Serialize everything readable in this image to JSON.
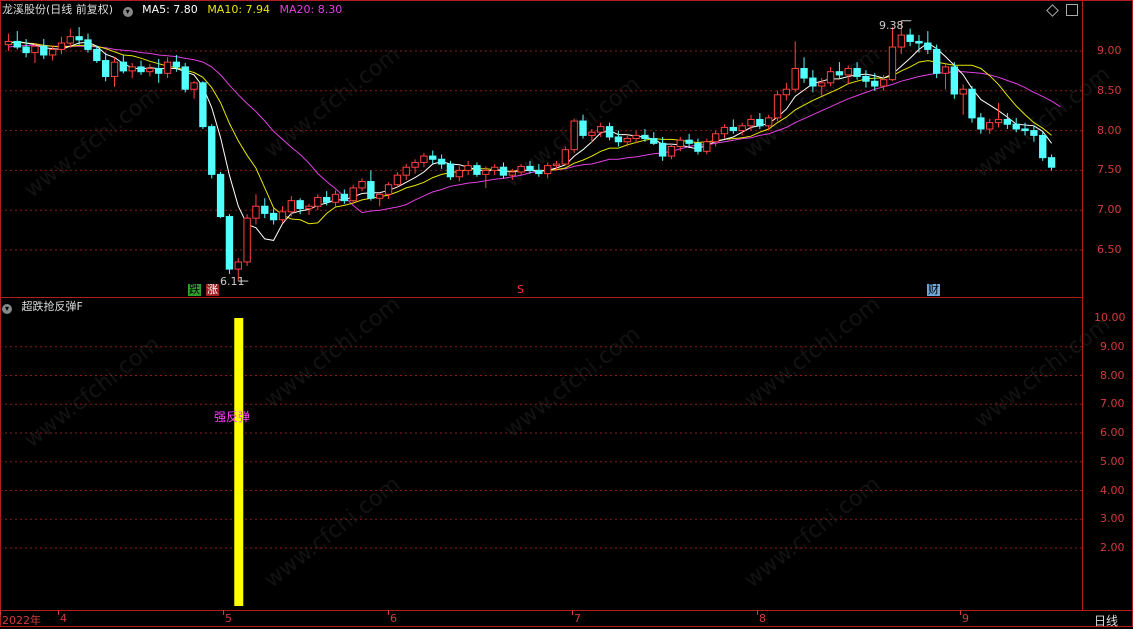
{
  "header": {
    "stock_name": "龙溪股份(日线 前复权)",
    "ma5_label": "MA5: 7.80",
    "ma10_label": "MA10: 7.94",
    "ma20_label": "MA20: 8.30",
    "indicator_name": "超跌抢反弹F",
    "period_label": "日线",
    "year_label": "2022年"
  },
  "colors": {
    "up": "#ff4040",
    "down": "#54ffff",
    "ma5": "#ffffff",
    "ma10": "#e6e600",
    "ma20": "#e040e0",
    "axis": "#d23c3c",
    "grid": "#8b1c1c",
    "signal_bar": "#ffff00",
    "signal_text": "#ff40ff"
  },
  "annotations": {
    "high_label": "9.38",
    "low_label": "6.11",
    "tag_die": "跌",
    "tag_zhang": "涨",
    "tag_s": "S",
    "tag_cai": "财",
    "signal_text": "强反弹"
  },
  "chart_data": [
    {
      "type": "candlestick",
      "title": "龙溪股份(日线 前复权)",
      "ylim": [
        6.11,
        9.38
      ],
      "y_ticks": [
        "9.00",
        "8.50",
        "8.00",
        "7.50",
        "7.00",
        "6.50"
      ],
      "x_ticks": [
        "2022年",
        "4",
        "5",
        "6",
        "7",
        "8",
        "9"
      ],
      "candles": [
        [
          9.08,
          9.22,
          9.0,
          9.12
        ],
        [
          9.12,
          9.25,
          9.02,
          9.05
        ],
        [
          9.05,
          9.15,
          8.92,
          8.98
        ],
        [
          8.98,
          9.1,
          8.85,
          9.06
        ],
        [
          9.06,
          9.15,
          8.9,
          8.95
        ],
        [
          8.95,
          9.06,
          8.88,
          9.02
        ],
        [
          9.02,
          9.18,
          8.96,
          9.1
        ],
        [
          9.1,
          9.28,
          9.04,
          9.18
        ],
        [
          9.18,
          9.3,
          9.08,
          9.14
        ],
        [
          9.14,
          9.22,
          8.98,
          9.02
        ],
        [
          9.02,
          9.06,
          8.85,
          8.88
        ],
        [
          8.88,
          8.98,
          8.62,
          8.68
        ],
        [
          8.68,
          8.92,
          8.55,
          8.86
        ],
        [
          8.86,
          8.95,
          8.72,
          8.75
        ],
        [
          8.75,
          8.85,
          8.66,
          8.8
        ],
        [
          8.8,
          8.88,
          8.7,
          8.74
        ],
        [
          8.74,
          8.84,
          8.68,
          8.78
        ],
        [
          8.78,
          8.9,
          8.6,
          8.72
        ],
        [
          8.72,
          8.92,
          8.66,
          8.86
        ],
        [
          8.86,
          8.95,
          8.74,
          8.8
        ],
        [
          8.8,
          8.85,
          8.48,
          8.52
        ],
        [
          8.52,
          8.62,
          8.4,
          8.6
        ],
        [
          8.6,
          8.62,
          8.02,
          8.05
        ],
        [
          8.05,
          8.08,
          7.4,
          7.45
        ],
        [
          7.45,
          7.48,
          6.9,
          6.92
        ],
        [
          6.92,
          6.95,
          6.2,
          6.26
        ],
        [
          6.26,
          6.4,
          6.11,
          6.35
        ],
        [
          6.35,
          6.95,
          6.3,
          6.9
        ],
        [
          6.9,
          7.2,
          6.82,
          7.05
        ],
        [
          7.05,
          7.15,
          6.9,
          6.96
        ],
        [
          6.96,
          7.02,
          6.82,
          6.88
        ],
        [
          6.88,
          7.05,
          6.84,
          6.98
        ],
        [
          6.98,
          7.18,
          6.92,
          7.12
        ],
        [
          7.12,
          7.15,
          6.95,
          7.02
        ],
        [
          7.02,
          7.08,
          6.94,
          7.05
        ],
        [
          7.05,
          7.2,
          7.0,
          7.16
        ],
        [
          7.16,
          7.24,
          7.06,
          7.1
        ],
        [
          7.1,
          7.25,
          7.04,
          7.2
        ],
        [
          7.2,
          7.26,
          7.08,
          7.12
        ],
        [
          7.12,
          7.32,
          7.08,
          7.28
        ],
        [
          7.28,
          7.4,
          7.24,
          7.36
        ],
        [
          7.36,
          7.5,
          7.12,
          7.15
        ],
        [
          7.15,
          7.22,
          7.05,
          7.2
        ],
        [
          7.2,
          7.35,
          7.14,
          7.32
        ],
        [
          7.32,
          7.48,
          7.28,
          7.44
        ],
        [
          7.44,
          7.58,
          7.38,
          7.54
        ],
        [
          7.54,
          7.64,
          7.46,
          7.6
        ],
        [
          7.6,
          7.72,
          7.54,
          7.68
        ],
        [
          7.68,
          7.75,
          7.58,
          7.64
        ],
        [
          7.64,
          7.7,
          7.52,
          7.58
        ],
        [
          7.58,
          7.62,
          7.38,
          7.42
        ],
        [
          7.42,
          7.55,
          7.36,
          7.5
        ],
        [
          7.5,
          7.62,
          7.44,
          7.56
        ],
        [
          7.56,
          7.6,
          7.42,
          7.45
        ],
        [
          7.45,
          7.55,
          7.28,
          7.5
        ],
        [
          7.5,
          7.58,
          7.44,
          7.54
        ],
        [
          7.54,
          7.6,
          7.4,
          7.44
        ],
        [
          7.44,
          7.52,
          7.38,
          7.48
        ],
        [
          7.48,
          7.58,
          7.44,
          7.55
        ],
        [
          7.55,
          7.62,
          7.46,
          7.5
        ],
        [
          7.5,
          7.58,
          7.42,
          7.46
        ],
        [
          7.46,
          7.6,
          7.4,
          7.56
        ],
        [
          7.56,
          7.62,
          7.5,
          7.58
        ],
        [
          7.58,
          7.8,
          7.56,
          7.76
        ],
        [
          7.76,
          8.15,
          7.72,
          8.12
        ],
        [
          8.12,
          8.2,
          7.9,
          7.94
        ],
        [
          7.94,
          8.02,
          7.85,
          7.98
        ],
        [
          7.98,
          8.1,
          7.92,
          8.05
        ],
        [
          8.05,
          8.1,
          7.88,
          7.92
        ],
        [
          7.92,
          8.0,
          7.8,
          7.86
        ],
        [
          7.86,
          7.96,
          7.8,
          7.9
        ],
        [
          7.9,
          8.0,
          7.84,
          7.94
        ],
        [
          7.94,
          8.02,
          7.86,
          7.9
        ],
        [
          7.9,
          7.98,
          7.82,
          7.84
        ],
        [
          7.84,
          7.92,
          7.62,
          7.68
        ],
        [
          7.68,
          7.84,
          7.64,
          7.8
        ],
        [
          7.8,
          7.92,
          7.74,
          7.88
        ],
        [
          7.88,
          7.96,
          7.8,
          7.84
        ],
        [
          7.84,
          7.9,
          7.7,
          7.74
        ],
        [
          7.74,
          7.9,
          7.7,
          7.86
        ],
        [
          7.86,
          8.0,
          7.8,
          7.96
        ],
        [
          7.96,
          8.08,
          7.9,
          8.04
        ],
        [
          8.04,
          8.14,
          7.96,
          8.0
        ],
        [
          8.0,
          8.1,
          7.94,
          8.06
        ],
        [
          8.06,
          8.2,
          8.0,
          8.14
        ],
        [
          8.14,
          8.22,
          8.02,
          8.06
        ],
        [
          8.06,
          8.2,
          8.0,
          8.16
        ],
        [
          8.16,
          8.5,
          8.12,
          8.45
        ],
        [
          8.45,
          8.6,
          8.38,
          8.52
        ],
        [
          8.52,
          9.12,
          8.48,
          8.78
        ],
        [
          8.78,
          8.92,
          8.6,
          8.66
        ],
        [
          8.66,
          8.76,
          8.48,
          8.56
        ],
        [
          8.56,
          8.66,
          8.44,
          8.6
        ],
        [
          8.6,
          8.8,
          8.56,
          8.74
        ],
        [
          8.74,
          8.86,
          8.66,
          8.7
        ],
        [
          8.7,
          8.82,
          8.58,
          8.78
        ],
        [
          8.78,
          8.86,
          8.64,
          8.68
        ],
        [
          8.68,
          8.76,
          8.54,
          8.62
        ],
        [
          8.62,
          8.72,
          8.5,
          8.56
        ],
        [
          8.56,
          8.7,
          8.5,
          8.64
        ],
        [
          8.64,
          9.3,
          8.62,
          9.05
        ],
        [
          9.05,
          9.38,
          8.96,
          9.2
        ],
        [
          9.2,
          9.28,
          9.06,
          9.12
        ],
        [
          9.12,
          9.2,
          8.98,
          9.1
        ],
        [
          9.1,
          9.25,
          8.96,
          9.02
        ],
        [
          9.02,
          9.08,
          8.66,
          8.72
        ],
        [
          8.72,
          8.84,
          8.52,
          8.8
        ],
        [
          8.8,
          8.86,
          8.4,
          8.46
        ],
        [
          8.46,
          8.58,
          8.2,
          8.52
        ],
        [
          8.52,
          8.56,
          8.1,
          8.16
        ],
        [
          8.16,
          8.22,
          7.96,
          8.02
        ],
        [
          8.02,
          8.15,
          7.96,
          8.1
        ],
        [
          8.1,
          8.35,
          8.04,
          8.14
        ],
        [
          8.14,
          8.22,
          8.02,
          8.08
        ],
        [
          8.08,
          8.16,
          7.98,
          8.02
        ],
        [
          8.02,
          8.1,
          7.94,
          8.0
        ],
        [
          8.0,
          8.06,
          7.86,
          7.94
        ],
        [
          7.94,
          7.98,
          7.62,
          7.66
        ],
        [
          7.66,
          7.7,
          7.5,
          7.54
        ]
      ],
      "ma5": [
        9.1,
        9.12,
        9.1,
        9.08,
        9.04,
        9.03,
        9.02,
        9.06,
        9.1,
        9.11,
        9.06,
        8.96,
        8.92,
        8.84,
        8.79,
        8.77,
        8.79,
        8.78,
        8.78,
        8.78,
        8.74,
        8.7,
        8.55,
        8.29,
        7.91,
        7.44,
        7.05,
        6.82,
        6.78,
        6.64,
        6.62,
        6.83,
        6.96,
        6.99,
        7.01,
        7.06,
        7.09,
        7.13,
        7.13,
        7.17,
        7.21,
        7.22,
        7.22,
        7.25,
        7.29,
        7.35,
        7.41,
        7.48,
        7.58,
        7.61,
        7.58,
        7.57,
        7.54,
        7.51,
        7.49,
        7.51,
        7.5,
        7.48,
        7.5,
        7.5,
        7.49,
        7.5,
        7.53,
        7.57,
        7.68,
        7.76,
        7.86,
        7.97,
        8.0,
        7.95,
        7.95,
        7.93,
        7.92,
        7.89,
        7.83,
        7.83,
        7.82,
        7.79,
        7.77,
        7.82,
        7.86,
        7.89,
        7.92,
        7.98,
        8.04,
        8.06,
        8.09,
        8.17,
        8.27,
        8.43,
        8.51,
        8.59,
        8.62,
        8.65,
        8.65,
        8.68,
        8.7,
        8.71,
        8.69,
        8.66,
        8.71,
        8.81,
        8.91,
        9.02,
        9.1,
        9.03,
        8.93,
        8.82,
        8.7,
        8.53,
        8.39,
        8.32,
        8.25,
        8.17,
        8.08,
        8.07,
        8.06,
        7.99,
        7.84
      ],
      "ma10": [
        9.1,
        9.11,
        9.1,
        9.09,
        9.07,
        9.06,
        9.05,
        9.06,
        9.07,
        9.07,
        9.06,
        9.03,
        8.99,
        8.95,
        8.94,
        8.91,
        8.87,
        8.84,
        8.81,
        8.79,
        8.76,
        8.73,
        8.67,
        8.54,
        8.35,
        8.09,
        7.87,
        7.69,
        7.53,
        7.28,
        7.03,
        6.94,
        6.89,
        6.88,
        6.83,
        6.84,
        6.96,
        7.04,
        7.06,
        7.09,
        7.13,
        7.15,
        7.17,
        7.19,
        7.23,
        7.28,
        7.31,
        7.35,
        7.41,
        7.45,
        7.47,
        7.49,
        7.51,
        7.52,
        7.52,
        7.51,
        7.49,
        7.49,
        7.5,
        7.5,
        7.5,
        7.5,
        7.51,
        7.53,
        7.59,
        7.63,
        7.68,
        7.74,
        7.78,
        7.78,
        7.82,
        7.85,
        7.88,
        7.9,
        7.89,
        7.89,
        7.88,
        7.86,
        7.85,
        7.86,
        7.87,
        7.89,
        7.9,
        7.91,
        7.93,
        7.98,
        8.02,
        8.1,
        8.17,
        8.26,
        8.32,
        8.38,
        8.43,
        8.48,
        8.53,
        8.59,
        8.62,
        8.65,
        8.66,
        8.66,
        8.69,
        8.75,
        8.8,
        8.86,
        8.88,
        8.86,
        8.84,
        8.82,
        8.82,
        8.82,
        8.78,
        8.69,
        8.58,
        8.44,
        8.31,
        8.2,
        8.1,
        8.03,
        7.94
      ],
      "ma20": [
        9.05,
        9.06,
        9.07,
        9.07,
        9.07,
        9.06,
        9.06,
        9.06,
        9.06,
        9.06,
        9.05,
        9.04,
        9.02,
        9.01,
        9.0,
        8.98,
        8.97,
        8.95,
        8.94,
        8.93,
        8.91,
        8.89,
        8.86,
        8.8,
        8.7,
        8.57,
        8.45,
        8.34,
        8.24,
        8.12,
        7.99,
        7.89,
        7.79,
        7.7,
        7.59,
        7.46,
        7.36,
        7.27,
        7.17,
        7.06,
        6.97,
        6.99,
        7.0,
        7.02,
        7.04,
        7.07,
        7.13,
        7.18,
        7.23,
        7.26,
        7.3,
        7.32,
        7.34,
        7.35,
        7.37,
        7.39,
        7.4,
        7.42,
        7.44,
        7.47,
        7.49,
        7.5,
        7.51,
        7.52,
        7.55,
        7.57,
        7.58,
        7.61,
        7.64,
        7.64,
        7.66,
        7.67,
        7.69,
        7.71,
        7.72,
        7.74,
        7.77,
        7.8,
        7.82,
        7.82,
        7.84,
        7.86,
        7.88,
        7.9,
        7.91,
        7.94,
        7.96,
        8.0,
        8.04,
        8.1,
        8.15,
        8.2,
        8.25,
        8.3,
        8.35,
        8.4,
        8.44,
        8.48,
        8.52,
        8.55,
        8.58,
        8.62,
        8.65,
        8.68,
        8.7,
        8.72,
        8.73,
        8.74,
        8.74,
        8.73,
        8.72,
        8.7,
        8.67,
        8.63,
        8.59,
        8.54,
        8.48,
        8.43,
        8.37,
        8.3
      ]
    },
    {
      "type": "bar",
      "title": "超跌抢反弹F",
      "ylim": [
        1.0,
        10.0
      ],
      "y_ticks": [
        "10.00",
        "9.00",
        "8.00",
        "7.00",
        "6.00",
        "5.00",
        "4.00",
        "3.00",
        "2.00"
      ],
      "signal_index": 26,
      "signal_value": 10.0,
      "signal_label": "强反弹"
    }
  ]
}
